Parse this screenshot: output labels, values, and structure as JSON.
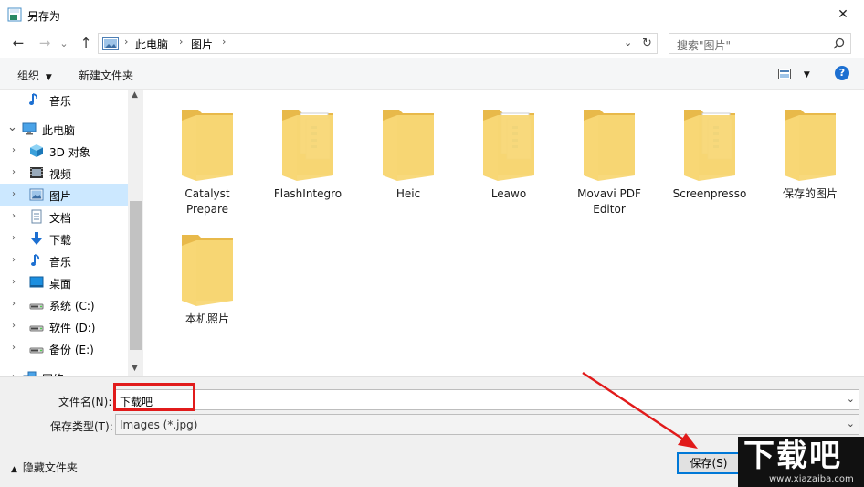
{
  "window": {
    "title": "另存为",
    "close": "✕"
  },
  "nav": {
    "back": "←",
    "forward": "→",
    "recent": "⌄",
    "up": "↑",
    "breadcrumbs": [
      "此电脑",
      "图片"
    ],
    "search_placeholder": "搜索\"图片\""
  },
  "toolbar": {
    "organize": "组织",
    "new_folder": "新建文件夹",
    "help": "?"
  },
  "sidebar": {
    "items": [
      {
        "label": "音乐",
        "icon": "music-icon"
      },
      {
        "label": "此电脑",
        "icon": "computer-icon"
      },
      {
        "label": "3D 对象",
        "icon": "cube-icon"
      },
      {
        "label": "视频",
        "icon": "video-icon"
      },
      {
        "label": "图片",
        "icon": "picture-icon",
        "selected": true
      },
      {
        "label": "文档",
        "icon": "document-icon"
      },
      {
        "label": "下载",
        "icon": "download-icon"
      },
      {
        "label": "音乐",
        "icon": "music-icon"
      },
      {
        "label": "桌面",
        "icon": "desktop-icon"
      },
      {
        "label": "系统 (C:)",
        "icon": "drive-icon"
      },
      {
        "label": "软件 (D:)",
        "icon": "drive-icon"
      },
      {
        "label": "备份 (E:)",
        "icon": "drive-icon"
      },
      {
        "label": "网络",
        "icon": "network-icon"
      }
    ]
  },
  "folders": [
    {
      "line1": "Catalyst",
      "line2": "Prepare",
      "has_docs": false
    },
    {
      "line1": "FlashIntegro",
      "line2": "",
      "has_docs": true
    },
    {
      "line1": "Heic",
      "line2": "",
      "has_docs": false
    },
    {
      "line1": "Leawo",
      "line2": "",
      "has_docs": true
    },
    {
      "line1": "Movavi PDF",
      "line2": "Editor",
      "has_docs": false
    },
    {
      "line1": "Screenpresso",
      "line2": "",
      "has_docs": true
    },
    {
      "line1": "保存的图片",
      "line2": "",
      "has_docs": false
    },
    {
      "line1": "本机照片",
      "line2": "",
      "has_docs": false
    }
  ],
  "form": {
    "filename_label": "文件名(N):",
    "filename_value": "下载吧",
    "filetype_label": "保存类型(T):",
    "filetype_value": "Images (*.jpg)"
  },
  "footer": {
    "hide_folders": "隐藏文件夹",
    "save": "保存(S)"
  },
  "watermark": {
    "brand": "下载吧",
    "url": "www.xiazaiba.com"
  },
  "colors": {
    "folder": "#f8d775",
    "folder_dark": "#e8b94a",
    "selection": "#cce8ff",
    "accent": "#0078d7",
    "annotation": "#e11b1b"
  }
}
